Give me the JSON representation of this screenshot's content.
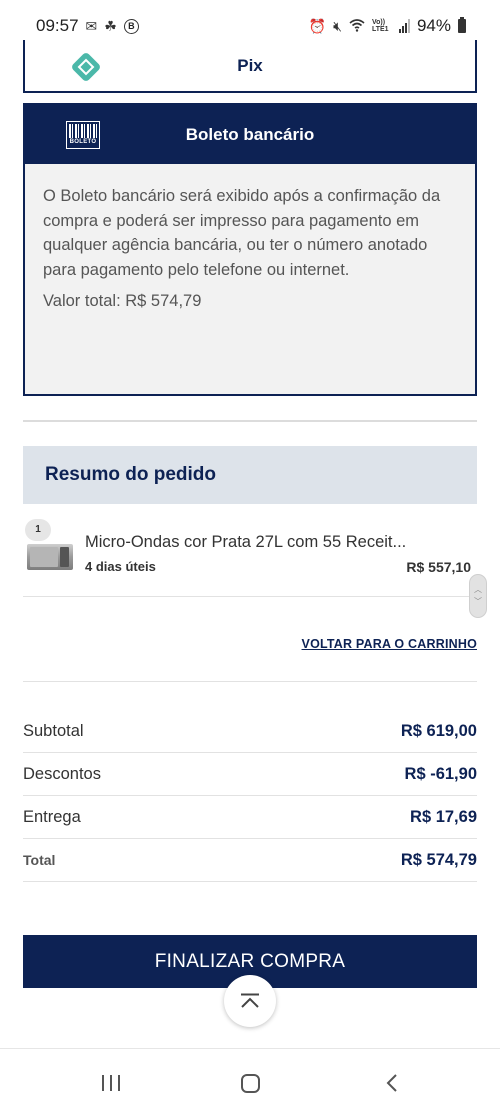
{
  "status_bar": {
    "time": "09:57",
    "battery": "94%",
    "network": "Vo)) LTE1"
  },
  "pix": {
    "label": "Pix",
    "icon": "pix-logo-icon",
    "brand_color": "#4bb8a9"
  },
  "boleto": {
    "title": "Boleto bancário",
    "icon_text": "BOLETO",
    "description": "O Boleto bancário será exibido após a confirmação da compra e poderá ser impresso para pagamento em qualquer agência bancária, ou ter o número anotado para pagamento pelo telefone ou internet.",
    "total_line": "Valor total: R$ 574,79"
  },
  "summary": {
    "title": "Resumo do pedido",
    "items": [
      {
        "quantity": "1",
        "name": "Micro-Ondas cor Prata 27L com 55 Receit...",
        "delivery": "4 dias úteis",
        "price": "R$ 557,10"
      }
    ],
    "back_to_cart": "VOLTAR PARA O CARRINHO"
  },
  "totals": {
    "subtotal_label": "Subtotal",
    "subtotal_value": "R$ 619,00",
    "discounts_label": "Descontos",
    "discounts_value": "R$ -61,90",
    "delivery_label": "Entrega",
    "delivery_value": "R$ 17,69",
    "total_label": "Total",
    "total_value": "R$ 574,79"
  },
  "checkout": {
    "button_label": "FINALIZAR COMPRA"
  },
  "colors": {
    "primary": "#0d2254",
    "summary_bg": "#dde3ea",
    "card_bg": "#f2f2f2"
  }
}
